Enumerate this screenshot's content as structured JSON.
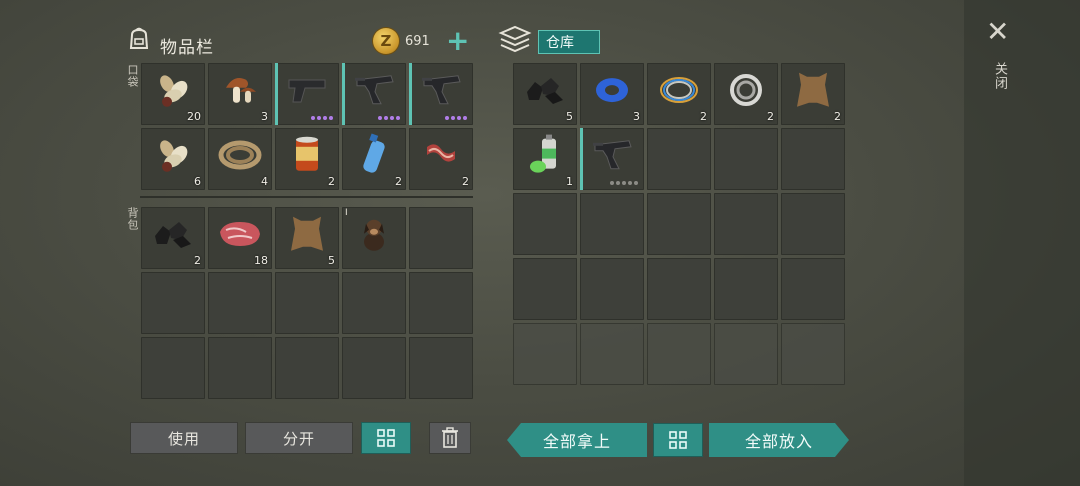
{
  "colors": {
    "accent": "#5ec3b4",
    "teal_button": "#2f8f86",
    "rarity_purple": "#b07ee8"
  },
  "inventory": {
    "title": "物品栏",
    "coins": "691",
    "plus_label": "+",
    "pocket_label": "口袋",
    "backpack_label": "背包"
  },
  "warehouse": {
    "title": "仓库"
  },
  "close": {
    "icon": "✕",
    "label": "关闭"
  },
  "buttons": {
    "use": "使用",
    "split": "分开",
    "sort_icon": "sort-grid-icon",
    "delete_icon": "trash-icon",
    "take_all": "全部拿上",
    "put_all": "全部放入"
  },
  "pocket": [
    {
      "item": "seeds",
      "count": "20"
    },
    {
      "item": "mushroom",
      "count": "3"
    },
    {
      "item": "pistol",
      "rarity": 4
    },
    {
      "item": "uzi",
      "rarity": 4
    },
    {
      "item": "uzi",
      "rarity": 4
    },
    {
      "item": "seeds",
      "count": "6"
    },
    {
      "item": "rope",
      "count": "4"
    },
    {
      "item": "canned-food",
      "count": "2"
    },
    {
      "item": "water-bottle",
      "count": "2"
    },
    {
      "item": "bacon",
      "count": "2"
    }
  ],
  "backpack": [
    {
      "item": "coal",
      "count": "2"
    },
    {
      "item": "raw-meat",
      "count": "18"
    },
    {
      "item": "leather",
      "count": "5"
    },
    {
      "item": "puppy",
      "count": "",
      "tag": "I"
    },
    {
      "item": "",
      "count": ""
    },
    {
      "item": "",
      "count": ""
    },
    {
      "item": "",
      "count": ""
    },
    {
      "item": "",
      "count": ""
    },
    {
      "item": "",
      "count": ""
    },
    {
      "item": "",
      "count": ""
    },
    {
      "item": "",
      "count": ""
    },
    {
      "item": "",
      "count": ""
    },
    {
      "item": "",
      "count": ""
    },
    {
      "item": "",
      "count": ""
    },
    {
      "item": "",
      "count": ""
    }
  ],
  "storage": [
    {
      "item": "coal",
      "count": "5"
    },
    {
      "item": "tape",
      "count": "3"
    },
    {
      "item": "wire",
      "count": "2"
    },
    {
      "item": "bearing",
      "count": "2"
    },
    {
      "item": "leather",
      "count": "2"
    },
    {
      "item": "spray-can",
      "count": "1"
    },
    {
      "item": "uzi",
      "rarity": 5,
      "gray": true
    }
  ]
}
